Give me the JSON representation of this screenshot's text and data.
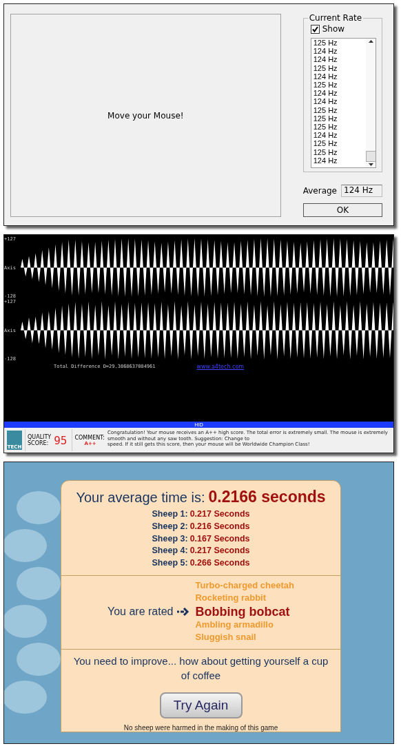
{
  "rate_dialog": {
    "prompt": "Move your Mouse!",
    "group_title": "Current Rate",
    "show": {
      "label": "Show",
      "checked": true
    },
    "rates": [
      "125 Hz",
      "124 Hz",
      "124 Hz",
      "125 Hz",
      "124 Hz",
      "125 Hz",
      "124 Hz",
      "124 Hz",
      "125 Hz",
      "125 Hz",
      "125 Hz",
      "124 Hz",
      "125 Hz",
      "125 Hz",
      "124 Hz"
    ],
    "average_label": "Average",
    "average_value": "124 Hz",
    "ok_button": "OK"
  },
  "waveform_viewer": {
    "channels": [
      {
        "top_label": "+127",
        "axis_label": "Axis",
        "bottom_label": "-128"
      },
      {
        "top_label": "+127",
        "axis_label": "Axis",
        "bottom_label": "-128"
      }
    ],
    "total_difference": "Total Difference D=29.3868637084961",
    "link": "www.a4tech.com",
    "bar_label": "HID",
    "logo_text": "TECH",
    "quality_label": "QUALITY",
    "score_label": "SCORE:",
    "score": "95",
    "comment_label": "COMMENT:",
    "grade": "A++",
    "comment_lines": [
      "Congratulation!  Your mouse receives an A++ high score.  The total error is extremely small.  The mouse is extremely smooth and without any saw tooth.  Suggestion:  Change to",
      "speed.  If it still gets this score, then your mouse will be Worldwide Champion Class!"
    ]
  },
  "results": {
    "average_label": "Your average time is:",
    "average_value": "0.2166 seconds",
    "sheep": [
      {
        "label": "Sheep 1:",
        "time": "0.217 Seconds"
      },
      {
        "label": "Sheep 2:",
        "time": "0.216 Seconds"
      },
      {
        "label": "Sheep 3:",
        "time": "0.167 Seconds"
      },
      {
        "label": "Sheep 4:",
        "time": "0.217 Seconds"
      },
      {
        "label": "Sheep 5:",
        "time": "0.266 Seconds"
      }
    ],
    "rated_label": "You are rated",
    "ratings": [
      {
        "label": "Turbo-charged cheetah",
        "selected": false
      },
      {
        "label": "Rocketing rabbit",
        "selected": false
      },
      {
        "label": "Bobbing bobcat",
        "selected": true
      },
      {
        "label": "Ambling armadillo",
        "selected": false
      },
      {
        "label": "Sluggish snail",
        "selected": false
      }
    ],
    "advice": "You need to improve... how about getting yourself a cup of coffee",
    "try_again_button": "Try Again",
    "footer": "No sheep were harmed in the making of this game"
  }
}
